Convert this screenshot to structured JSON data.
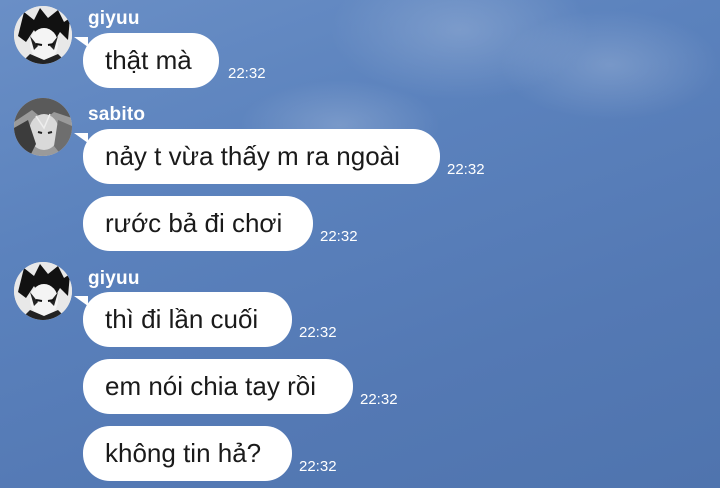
{
  "chat": {
    "groups": [
      {
        "sender": "giyuu",
        "messages": [
          {
            "text": "thật mà",
            "time": "22:32"
          }
        ]
      },
      {
        "sender": "sabito",
        "messages": [
          {
            "text": "nảy t vừa thấy m ra ngoài",
            "time": "22:32"
          },
          {
            "text": "rước bả đi chơi",
            "time": "22:32"
          }
        ]
      },
      {
        "sender": "giyuu",
        "messages": [
          {
            "text": "thì đi lần cuối",
            "time": "22:32"
          },
          {
            "text": "em nói chia tay rồi",
            "time": "22:32"
          },
          {
            "text": "không tin hả?",
            "time": "22:32"
          }
        ]
      }
    ]
  },
  "colors": {
    "background": "#5b82bd",
    "bubble": "#ffffff",
    "meta_text": "#ffffff"
  }
}
